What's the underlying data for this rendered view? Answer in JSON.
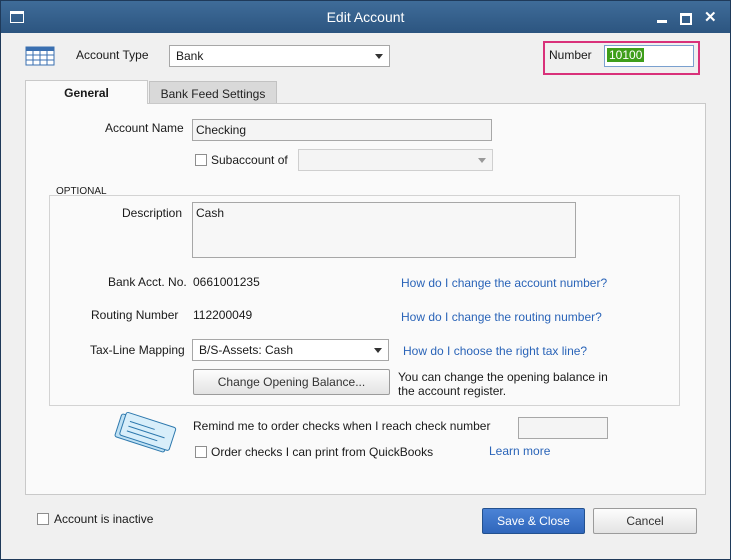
{
  "window": {
    "title": "Edit Account"
  },
  "account_type": {
    "label": "Account Type",
    "value": "Bank"
  },
  "number": {
    "label": "Number",
    "value": "10100"
  },
  "tabs": [
    {
      "label": "General"
    },
    {
      "label": "Bank Feed Settings"
    }
  ],
  "general": {
    "account_name_label": "Account Name",
    "account_name_value": "Checking",
    "subaccount_label": "Subaccount of",
    "subaccount_value": "",
    "optional_label": "OPTIONAL",
    "description_label": "Description",
    "description_value": "Cash",
    "bank_acct_label": "Bank Acct. No.",
    "bank_acct_value": "0661001235",
    "bank_acct_help": "How do I change the account number?",
    "routing_label": "Routing Number",
    "routing_value": "112200049",
    "routing_help": "How do I change the routing number?",
    "taxline_label": "Tax-Line Mapping",
    "taxline_value": "B/S-Assets: Cash",
    "taxline_help": "How do I choose the right tax line?",
    "opening_balance_button": "Change Opening Balance...",
    "opening_balance_note_1": "You can change the opening balance in",
    "opening_balance_note_2": "the account register.",
    "remind_label": "Remind me to order checks when I reach check number",
    "remind_value": "",
    "order_checks_label": "Order checks I can print from QuickBooks",
    "learn_more": "Learn more"
  },
  "footer": {
    "inactive_label": "Account is inactive",
    "save_close": "Save & Close",
    "cancel": "Cancel"
  }
}
